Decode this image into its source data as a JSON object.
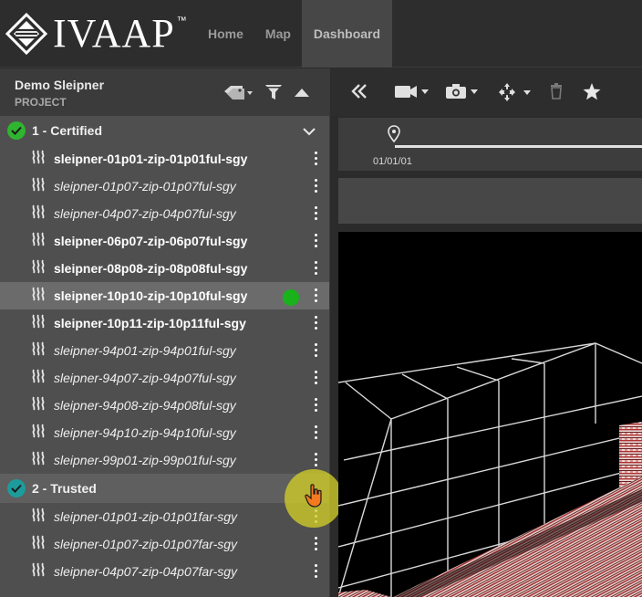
{
  "app": {
    "logo_text": "IVAAP",
    "logo_tm": "™"
  },
  "nav": {
    "tabs": [
      {
        "label": "Home",
        "active": false
      },
      {
        "label": "Map",
        "active": false
      },
      {
        "label": "Dashboard",
        "active": true
      }
    ]
  },
  "project": {
    "name": "Demo Sleipner",
    "subtitle": "PROJECT",
    "tools": [
      "tag-icon",
      "filter-icon",
      "collapse-up-icon"
    ]
  },
  "groups": [
    {
      "title": "1 - Certified",
      "badge_color": "#2fb52f",
      "expanded": true,
      "items": [
        {
          "label": "sleipner-01p01-zip-01p01ful-sgy",
          "style": "bold"
        },
        {
          "label": "sleipner-01p07-zip-01p07ful-sgy",
          "style": "italic"
        },
        {
          "label": "sleipner-04p07-zip-04p07ful-sgy",
          "style": "italic"
        },
        {
          "label": "sleipner-06p07-zip-06p07ful-sgy",
          "style": "bold"
        },
        {
          "label": "sleipner-08p08-zip-08p08ful-sgy",
          "style": "bold"
        },
        {
          "label": "sleipner-10p10-zip-10p10ful-sgy",
          "style": "bold",
          "selected": true,
          "status_color": "#19b21b"
        },
        {
          "label": "sleipner-10p11-zip-10p11ful-sgy",
          "style": "bold"
        },
        {
          "label": "sleipner-94p01-zip-94p01ful-sgy",
          "style": "italic"
        },
        {
          "label": "sleipner-94p07-zip-94p07ful-sgy",
          "style": "italic"
        },
        {
          "label": "sleipner-94p08-zip-94p08ful-sgy",
          "style": "italic"
        },
        {
          "label": "sleipner-94p10-zip-94p10ful-sgy",
          "style": "italic"
        },
        {
          "label": "sleipner-99p01-zip-99p01ful-sgy",
          "style": "italic"
        }
      ]
    },
    {
      "title": "2 - Trusted",
      "badge_color": "#1e9b9b",
      "expanded": true,
      "items": [
        {
          "label": "sleipner-01p01-zip-01p01far-sgy",
          "style": "italic"
        },
        {
          "label": "sleipner-01p07-zip-01p07far-sgy",
          "style": "italic"
        },
        {
          "label": "sleipner-04p07-zip-04p07far-sgy",
          "style": "italic"
        }
      ]
    }
  ],
  "toolbar": {
    "tools": [
      "double-chevron-left-icon",
      "camera-video-icon",
      "camera-photo-icon",
      "move-icon",
      "trash-icon",
      "star-icon"
    ]
  },
  "timeline": {
    "date": "01/01/01"
  }
}
